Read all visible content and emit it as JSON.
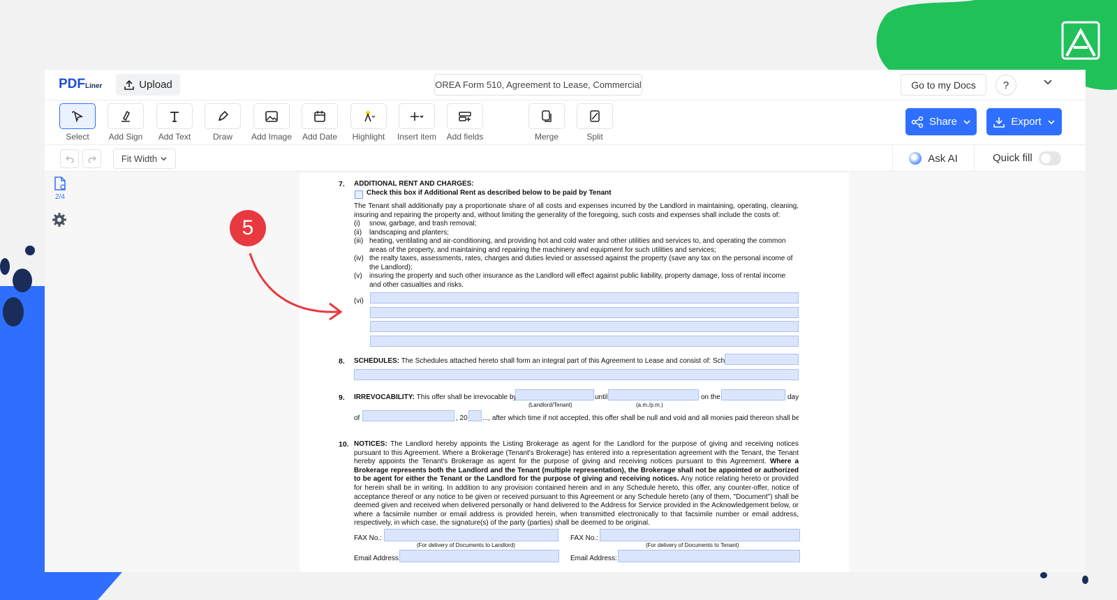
{
  "header": {
    "logo_main": "PDF",
    "logo_sub": "Liner",
    "upload_label": "Upload",
    "document_title": "OREA Form 510, Agreement to Lease, Commercial",
    "go_to_docs_label": "Go to my Docs",
    "help_label": "?"
  },
  "toolbar": {
    "tools": [
      {
        "label": "Select",
        "icon": "select-cursor-icon"
      },
      {
        "label": "Add Sign",
        "icon": "pen-sign-icon"
      },
      {
        "label": "Add Text",
        "icon": "text-icon"
      },
      {
        "label": "Draw",
        "icon": "pen-draw-icon"
      },
      {
        "label": "Add Image",
        "icon": "image-icon"
      },
      {
        "label": "Add Date",
        "icon": "calendar-icon"
      },
      {
        "label": "Highlight",
        "icon": "highlighter-icon"
      },
      {
        "label": "Insert item",
        "icon": "plus-icon"
      },
      {
        "label": "Add fields",
        "icon": "add-fields-icon"
      },
      {
        "label": "Merge",
        "icon": "merge-icon"
      },
      {
        "label": "Split",
        "icon": "split-icon"
      }
    ],
    "share_label": "Share",
    "export_label": "Export"
  },
  "subbar": {
    "zoom_label": "Fit Width",
    "ask_ai_label": "Ask AI",
    "quick_fill_label": "Quick fill",
    "quick_fill_on": false
  },
  "sidebar": {
    "page_indicator": "2/4"
  },
  "annotation": {
    "step_number": "5",
    "color": "#e7393f"
  },
  "document": {
    "s7_num": "7.",
    "s7_title": "ADDITIONAL RENT AND CHARGES:",
    "s7_checkbox_label": "Check this box if Additional Rent as described below to be paid by Tenant",
    "s7_intro": "The Tenant shall additionally pay a proportionate share of all costs and expenses incurred by the Landlord in maintaining, operating, cleaning, insuring and repairing the property and, without limiting the generality of the foregoing, such costs and expenses shall include the costs of:",
    "s7_items": [
      {
        "n": "(i)",
        "t": "snow, garbage, and trash removal;"
      },
      {
        "n": "(ii)",
        "t": "landscaping and planters;"
      },
      {
        "n": "(iii)",
        "t": "heating, ventilating and air-conditioning, and providing hot and cold water and other utilities and services to, and operating the common areas of the property, and maintaining and repairing the machinery and equipment for such utilities and services;"
      },
      {
        "n": "(iv)",
        "t": "the realty taxes, assessments, rates, charges and duties levied or assessed against the property (save any tax on the personal income of the Landlord);"
      },
      {
        "n": "(v)",
        "t": "insuring the property and such other insurance as the Landlord will effect against public liability, property damage, loss of rental income and other casualties and risks."
      }
    ],
    "s7_item_vi": "(vi)",
    "s8_num": "8.",
    "s8_title": "SCHEDULES:",
    "s8_text": "The Schedules attached hereto shall form an integral part of this Agreement to Lease and consist of: Schedule(s)",
    "s9_num": "9.",
    "s9_title": "IRREVOCABILITY:",
    "s9_text_a": "This offer shall be irrevocable by",
    "s9_until": "until",
    "s9_on_the": "on the",
    "s9_day": "day",
    "s9_cap_party": "(Landlord/Tenant)",
    "s9_cap_ampm": "(a.m./p.m.)",
    "s9_of": "of",
    "s9_year_prefix": ", 20",
    "s9_text_b": "..., after which time if not accepted, this offer shall be null and void and all monies paid thereon shall be returned to the Tenant without interest or deduction.",
    "s10_num": "10.",
    "s10_title": "NOTICES:",
    "s10_text_a": "The Landlord hereby appoints the Listing Brokerage as agent for the Landlord for the purpose of giving and receiving notices pursuant to this Agreement. Where a Brokerage (Tenant's Brokerage) has entered into a representation agreement with the Tenant, the Tenant hereby appoints the Tenant's Brokerage as agent for the purpose of giving and receiving notices pursuant to this Agreement.",
    "s10_text_bold": "Where a Brokerage represents both the Landlord and the Tenant (multiple representation), the Brokerage shall not be appointed or authorized to be agent for either the Tenant or the Landlord for the purpose of giving and receiving notices.",
    "s10_text_b": "Any notice relating hereto or provided for herein shall be in writing. In addition to any provision contained herein and in any Schedule hereto, this offer, any counter-offer, notice of acceptance thereof or any notice to be given or received pursuant to this Agreement or any Schedule hereto (any of them, \"Document\") shall be deemed given and received when delivered personally or hand delivered to the Address for Service provided in the Acknowledgement below, or where a facsimile number or email address is provided herein, when transmitted electronically to that facsimile number or email address, respectively, in which case, the signature(s) of the party (parties) shall be deemed to be original.",
    "fax_label": "FAX No.:",
    "email_label": "Email Address:",
    "cap_landlord": "(For delivery of Documents to Landlord)",
    "cap_tenant": "(For delivery of Documents to Tenant)"
  }
}
